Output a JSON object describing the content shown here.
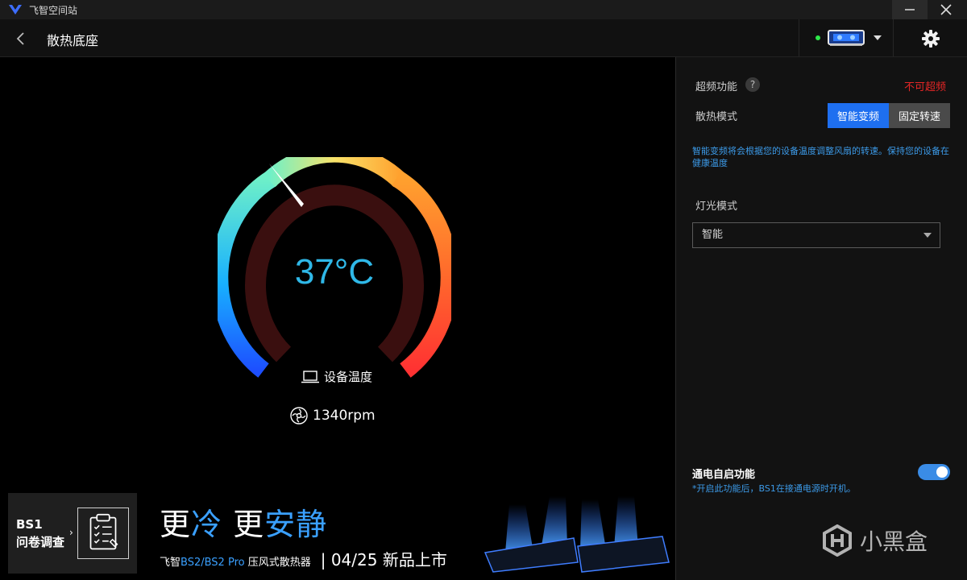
{
  "window": {
    "title": "飞智空间站"
  },
  "header": {
    "title": "散热底座"
  },
  "gauge": {
    "temperature": "37°C",
    "temperature_label": "设备温度",
    "fan_speed": "1340rpm"
  },
  "panel": {
    "overclock_label": "超频功能",
    "overclock_help": "?",
    "overclock_status": "不可超频",
    "cooling_mode_label": "散热模式",
    "mode_smart": "智能变频",
    "mode_fixed": "固定转速",
    "mode_description": "智能变频将会根据您的设备温度调整风扇的转速。保持您的设备在健康温度",
    "light_mode_label": "灯光模式",
    "light_mode_value": "智能",
    "power_on_title": "通电自启功能",
    "power_on_note": "*开启此功能后，BS1在接通电源时开机。",
    "power_on_enabled": true
  },
  "banner": {
    "survey_line1": "BS1",
    "survey_line2": "问卷调查",
    "headline_a": "更",
    "headline_b": "冷",
    "headline_c": "更",
    "headline_d": "安静",
    "sub_brand": "飞智",
    "sub_model": "BS2/BS2 Pro",
    "sub_type": "压风式散热器",
    "sub_date": "| 04/25  新品上市"
  },
  "watermark": {
    "text": "小黑盒"
  },
  "colors": {
    "accent_blue": "#1e6ff0",
    "temp_text": "#2fb8e8",
    "warning_red": "#e52626",
    "status_green": "#2ee84a"
  }
}
